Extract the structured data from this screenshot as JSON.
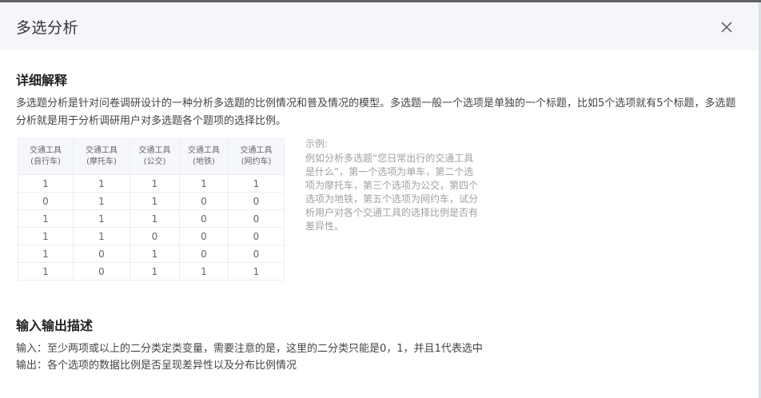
{
  "dialog": {
    "title": "多选分析"
  },
  "icons": {
    "close": "close-icon"
  },
  "colors": {
    "header_bg": "#f4f6fa",
    "table_header_bg": "#f5f7fa",
    "note_text": "#a0a0a0"
  },
  "section1": {
    "title": "详细解释",
    "description": "多选题分析是针对问卷调研设计的一种分析多选题的比例情况和普及情况的模型。多选题一般一个选项是单独的一个标题，比如5个选项就有5个标题，多选题分析就是用于分析调研用户对多选题各个题项的选择比例。"
  },
  "example_table": {
    "headers": [
      {
        "line1": "交通工具",
        "line2": "(自行车)"
      },
      {
        "line1": "交通工具",
        "line2": "(摩托车)"
      },
      {
        "line1": "交通工具",
        "line2": "(公交)"
      },
      {
        "line1": "交通工具",
        "line2": "(地铁)"
      },
      {
        "line1": "交通工具",
        "line2": "(网约车)"
      }
    ],
    "rows": [
      [
        "1",
        "1",
        "1",
        "1",
        "1"
      ],
      [
        "0",
        "1",
        "1",
        "0",
        "0"
      ],
      [
        "1",
        "1",
        "1",
        "0",
        "0"
      ],
      [
        "1",
        "1",
        "0",
        "0",
        "0"
      ],
      [
        "1",
        "0",
        "1",
        "0",
        "0"
      ],
      [
        "1",
        "0",
        "1",
        "1",
        "1"
      ]
    ]
  },
  "example_note": {
    "title": "示例:",
    "text": "例如分析多选题“您日常出行的交通工具是什么”，第一个选项为单车，第二个选项为摩托车，第三个选项为公交，第四个选项为地铁，第五个选项为网约车，试分析用户对各个交通工具的选择比例是否有差异性。"
  },
  "section2": {
    "title": "输入输出描述",
    "input": "输入：至少两项或以上的二分类定类变量，需要注意的是，这里的二分类只能是0，1，并且1代表选中",
    "output": "输出：各个选项的数据比例是否呈现差异性以及分布比例情况"
  }
}
